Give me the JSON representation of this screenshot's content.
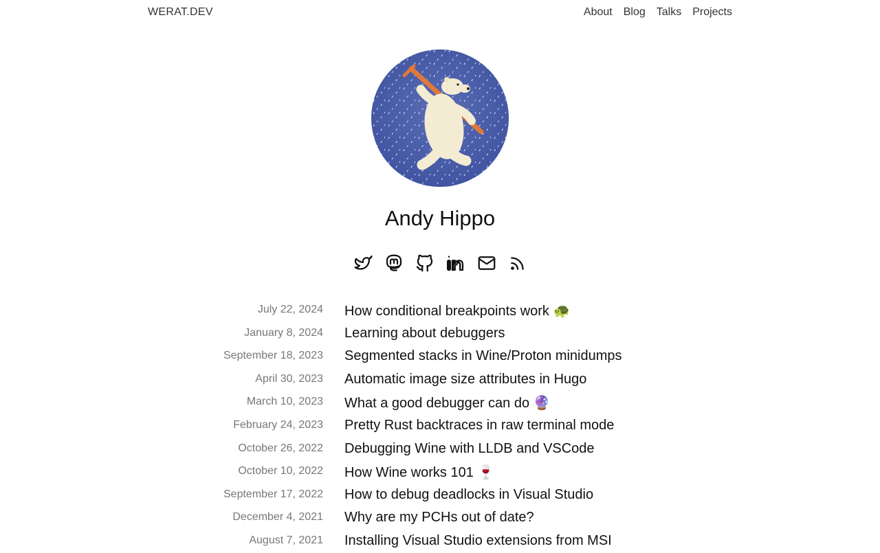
{
  "header": {
    "brand": "WERAT.DEV",
    "nav": [
      {
        "label": "About"
      },
      {
        "label": "Blog"
      },
      {
        "label": "Talks"
      },
      {
        "label": "Projects"
      }
    ]
  },
  "profile": {
    "name": "Andy Hippo",
    "avatar_icon": "polar-bear-with-skis-illustration",
    "socials": [
      {
        "icon": "twitter-icon"
      },
      {
        "icon": "mastodon-icon"
      },
      {
        "icon": "github-icon"
      },
      {
        "icon": "linkedin-icon"
      },
      {
        "icon": "email-icon"
      },
      {
        "icon": "rss-icon"
      }
    ]
  },
  "posts": [
    {
      "date": "July 22, 2024",
      "title": "How conditional breakpoints work 🐢"
    },
    {
      "date": "January 8, 2024",
      "title": "Learning about debuggers"
    },
    {
      "date": "September 18, 2023",
      "title": "Segmented stacks in Wine/Proton minidumps"
    },
    {
      "date": "April 30, 2023",
      "title": "Automatic image size attributes in Hugo"
    },
    {
      "date": "March 10, 2023",
      "title": "What a good debugger can do 🔮"
    },
    {
      "date": "February 24, 2023",
      "title": "Pretty Rust backtraces in raw terminal mode"
    },
    {
      "date": "October 26, 2022",
      "title": "Debugging Wine with LLDB and VSCode"
    },
    {
      "date": "October 10, 2022",
      "title": "How Wine works 101 🍷"
    },
    {
      "date": "September 17, 2022",
      "title": "How to debug deadlocks in Visual Studio"
    },
    {
      "date": "December 4, 2021",
      "title": "Why are my PCHs out of date?"
    },
    {
      "date": "August 7, 2021",
      "title": "Installing Visual Studio extensions from MSI"
    }
  ],
  "colors": {
    "text": "#111111",
    "muted": "#777777",
    "avatar_bg": "#4a5ea8"
  }
}
